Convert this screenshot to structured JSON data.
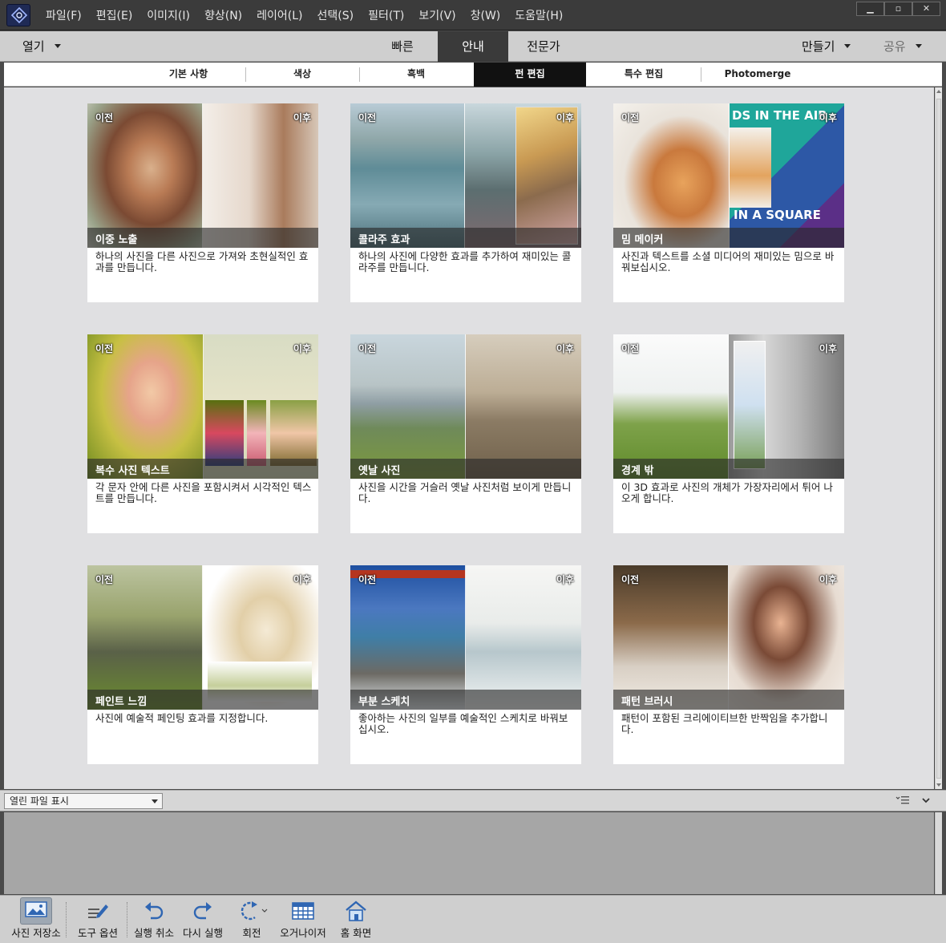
{
  "menu": [
    "파일(F)",
    "편집(E)",
    "이미지(I)",
    "향상(N)",
    "레이어(L)",
    "선택(S)",
    "필터(T)",
    "보기(V)",
    "창(W)",
    "도움말(H)"
  ],
  "modebar": {
    "open": "열기",
    "modes": [
      "빠른",
      "안내",
      "전문가"
    ],
    "active_mode": "안내",
    "create": "만들기",
    "share": "공유"
  },
  "categories": [
    "기본 사항",
    "색상",
    "흑백",
    "펀 편집",
    "특수 편집",
    "Photomerge"
  ],
  "active_category": "펀 편집",
  "labels": {
    "before": "이전",
    "after": "이후"
  },
  "cards": [
    {
      "title": "이중 노출",
      "desc": "하나의 사진을 다른 사진으로 가져와 초현실적인 효과를 만듭니다."
    },
    {
      "title": "콜라주 효과",
      "desc": "하나의 사진에 다양한 효과를 추가하여 재미있는 콜라주를 만듭니다."
    },
    {
      "title": "밈 메이커",
      "desc": "사진과 텍스트를 소셜 미디어의 재미있는 밈으로 바꿔보십시오.",
      "meme_top": "DS IN THE AIR",
      "meme_bottom": "IN A SQUARE"
    },
    {
      "title": "복수 사진 텍스트",
      "desc": "각 문자 안에 다른 사진을 포함시켜서 시각적인 텍스트를 만듭니다."
    },
    {
      "title": "옛날 사진",
      "desc": "사진을 시간을 거슬러 옛날 사진처럼 보이게 만듭니다."
    },
    {
      "title": "경계 밖",
      "desc": "이 3D 효과로 사진의 개체가 가장자리에서 튀어 나오게 합니다."
    },
    {
      "title": "페인트 느낌",
      "desc": "사진에 예술적 페인팅 효과를 지정합니다."
    },
    {
      "title": "부분 스케치",
      "desc": "좋아하는 사진의 일부를 예술적인 스케치로 바꿔보십시오."
    },
    {
      "title": "패턴 브러시",
      "desc": "패턴이 포함된 크리에이티브한 반짝임을 추가합니다."
    }
  ],
  "panel": {
    "dropdown": "열린 파일 표시"
  },
  "toolbar": [
    {
      "label": "사진 저장소",
      "icon": "photo-bin-icon"
    },
    {
      "label": "도구 옵션",
      "icon": "tool-options-icon"
    },
    {
      "label": "실행 취소",
      "icon": "undo-icon"
    },
    {
      "label": "다시 실행",
      "icon": "redo-icon"
    },
    {
      "label": "회전",
      "icon": "rotate-icon"
    },
    {
      "label": "오거나이저",
      "icon": "organizer-icon"
    },
    {
      "label": "홈 화면",
      "icon": "home-icon"
    }
  ],
  "colors": {
    "accent_dark": "#3a3a3a",
    "active_category_bg": "#111111",
    "workspace_bg": "#e0e0e2"
  }
}
